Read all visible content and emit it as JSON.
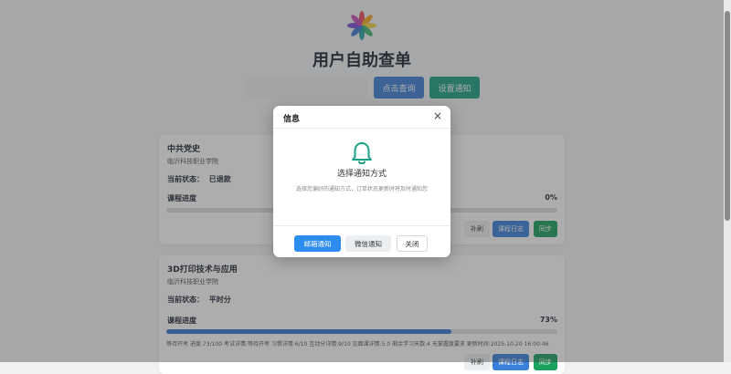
{
  "page": {
    "title": "用户自助查单"
  },
  "search": {
    "value": "",
    "placeholder": ""
  },
  "toolbar": {
    "query_label": "点击查询",
    "notify_label": "设置通知"
  },
  "cards": [
    {
      "course": "中共党史",
      "school": "临沂科技职业学院",
      "status_label": "当前状态：",
      "status_value": "已退款",
      "progress_label": "课程进度",
      "progress_text": "0%",
      "progress_fraction": 0.0,
      "detail": "",
      "buttons": {
        "refresh": "补刷",
        "log": "课程日志",
        "sync": "同步"
      }
    },
    {
      "course": "3D打印技术与应用",
      "school": "临沂科技职业学院",
      "status_label": "当前状态：",
      "status_value": "平时分",
      "progress_label": "课程进度",
      "progress_text": "73%",
      "progress_fraction": 0.73,
      "detail": "等待开考 进度:73/100 考试详情:等待开考 习惯详情:6/10 互动分详情:9/10 见面课详情:5.0 剩余学习天数:4 无掌握度要求 更新时间:2025-10-20 16:00:46",
      "buttons": {
        "refresh": "补刷",
        "log": "课程日志",
        "sync": "同步"
      }
    }
  ],
  "modal": {
    "title": "信息",
    "close_glyph": "×",
    "icon": "bell-icon",
    "heading": "选择通知方式",
    "description": "选择您偏好的通知方式，订单状态更新时将及时通知您",
    "email_label": "邮箱通知",
    "wechat_label": "微信通知",
    "close_label": "关闭"
  },
  "colors": {
    "primary": "#3f7fd8",
    "teal": "#1aa183",
    "green": "#19a15d",
    "modal_primary": "#2d8cf0",
    "bell": "#1aa183"
  }
}
